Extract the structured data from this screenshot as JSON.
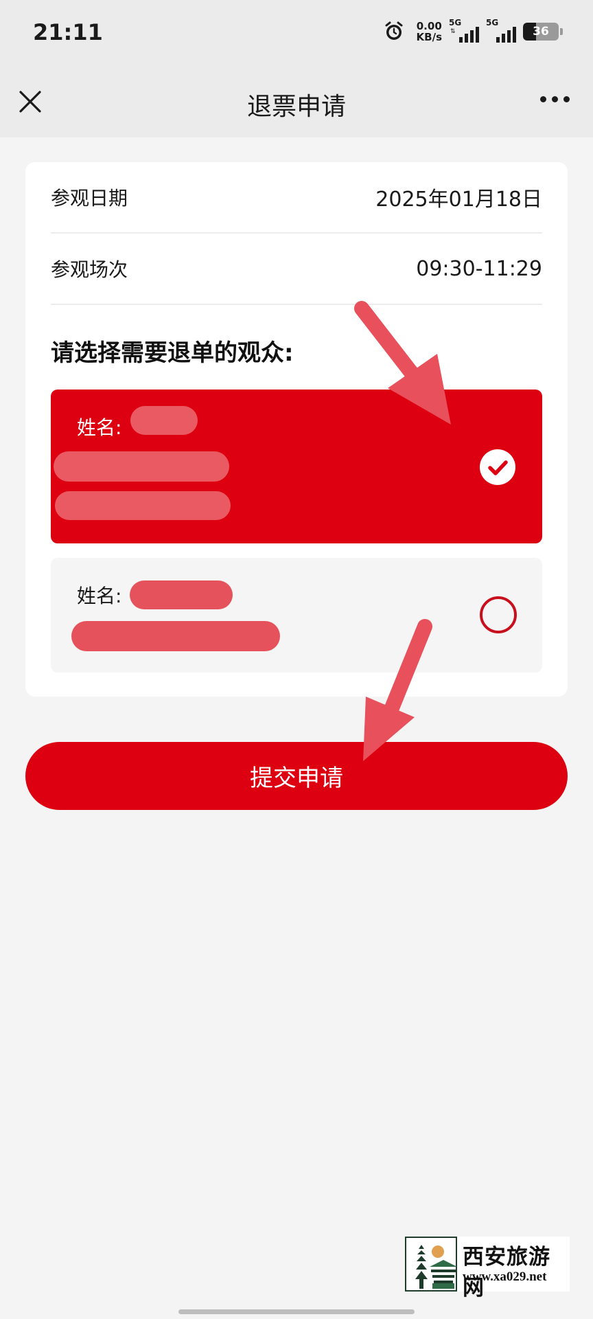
{
  "status_bar": {
    "time": "21:11",
    "net_speed_value": "0.00",
    "net_speed_unit": "KB/s",
    "sim1_label": "5G",
    "sim2_label": "5G",
    "battery": "36",
    "battery_level_percent": 36
  },
  "nav": {
    "title": "退票申请",
    "close_icon": "close-icon",
    "more_icon": "more-dots-icon"
  },
  "info": {
    "date_label": "参观日期",
    "date_value": "2025年01月18日",
    "session_label": "参观场次",
    "session_value": "09:30-11:29"
  },
  "section": {
    "title": "请选择需要退单的观众:"
  },
  "audience": [
    {
      "name_label": "姓名:",
      "selected": true
    },
    {
      "name_label": "姓名:",
      "selected": false
    }
  ],
  "submit": {
    "label": "提交申请"
  },
  "watermark": {
    "site_name": "西安旅游网",
    "url": "www.xa029.net"
  },
  "colors": {
    "accent": "#dc0010",
    "redaction": "#e5525c",
    "annotation_arrow": "#e8505b",
    "background": "#f4f4f4"
  }
}
